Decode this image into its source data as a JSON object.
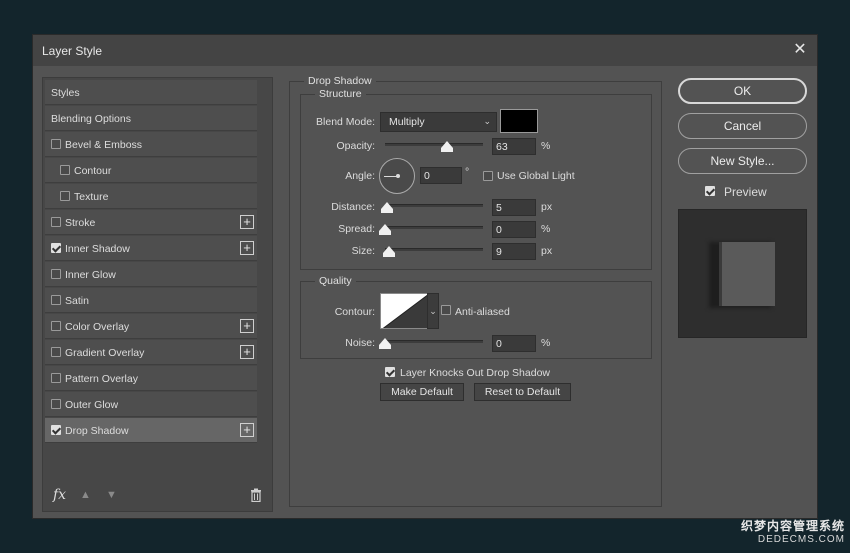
{
  "dialog": {
    "title": "Layer Style"
  },
  "styles_list": {
    "items": [
      {
        "label": "Styles",
        "has_checkbox": false,
        "checked": false,
        "indent": false,
        "has_plus": false,
        "selected": false
      },
      {
        "label": "Blending Options",
        "has_checkbox": false,
        "checked": false,
        "indent": false,
        "has_plus": false,
        "selected": false
      },
      {
        "label": "Bevel & Emboss",
        "has_checkbox": true,
        "checked": false,
        "indent": false,
        "has_plus": false,
        "selected": false
      },
      {
        "label": "Contour",
        "has_checkbox": true,
        "checked": false,
        "indent": true,
        "has_plus": false,
        "selected": false
      },
      {
        "label": "Texture",
        "has_checkbox": true,
        "checked": false,
        "indent": true,
        "has_plus": false,
        "selected": false
      },
      {
        "label": "Stroke",
        "has_checkbox": true,
        "checked": false,
        "indent": false,
        "has_plus": true,
        "selected": false
      },
      {
        "label": "Inner Shadow",
        "has_checkbox": true,
        "checked": true,
        "indent": false,
        "has_plus": true,
        "selected": false
      },
      {
        "label": "Inner Glow",
        "has_checkbox": true,
        "checked": false,
        "indent": false,
        "has_plus": false,
        "selected": false
      },
      {
        "label": "Satin",
        "has_checkbox": true,
        "checked": false,
        "indent": false,
        "has_plus": false,
        "selected": false
      },
      {
        "label": "Color Overlay",
        "has_checkbox": true,
        "checked": false,
        "indent": false,
        "has_plus": true,
        "selected": false
      },
      {
        "label": "Gradient Overlay",
        "has_checkbox": true,
        "checked": false,
        "indent": false,
        "has_plus": true,
        "selected": false
      },
      {
        "label": "Pattern Overlay",
        "has_checkbox": true,
        "checked": false,
        "indent": false,
        "has_plus": false,
        "selected": false
      },
      {
        "label": "Outer Glow",
        "has_checkbox": true,
        "checked": false,
        "indent": false,
        "has_plus": false,
        "selected": false
      },
      {
        "label": "Drop Shadow",
        "has_checkbox": true,
        "checked": true,
        "indent": false,
        "has_plus": true,
        "selected": true
      }
    ],
    "plus_glyph": "+",
    "bottom": {
      "fx": "fx",
      "up": "▲",
      "down": "▼"
    }
  },
  "drop_shadow": {
    "section_title": "Drop Shadow",
    "structure": {
      "title": "Structure",
      "blend_mode_label": "Blend Mode:",
      "blend_mode_value": "Multiply",
      "shadow_color": "#000000",
      "opacity_label": "Opacity:",
      "opacity_value": "63",
      "opacity_unit": "%",
      "opacity_fraction": 0.63,
      "angle_label": "Angle:",
      "angle_value": "0",
      "angle_unit": "°",
      "use_global_light_label": "Use Global Light",
      "use_global_light_checked": false,
      "distance_label": "Distance:",
      "distance_value": "5",
      "distance_unit": "px",
      "distance_fraction": 0.02,
      "spread_label": "Spread:",
      "spread_value": "0",
      "spread_unit": "%",
      "spread_fraction": 0.0,
      "size_label": "Size:",
      "size_value": "9",
      "size_unit": "px",
      "size_fraction": 0.04
    },
    "quality": {
      "title": "Quality",
      "contour_label": "Contour:",
      "anti_aliased_label": "Anti-aliased",
      "anti_aliased_checked": false,
      "noise_label": "Noise:",
      "noise_value": "0",
      "noise_unit": "%",
      "noise_fraction": 0.0
    },
    "knocks_out_label": "Layer Knocks Out Drop Shadow",
    "knocks_out_checked": true,
    "make_default_label": "Make Default",
    "reset_default_label": "Reset to Default"
  },
  "actions": {
    "ok_label": "OK",
    "cancel_label": "Cancel",
    "new_style_label": "New Style...",
    "preview_label": "Preview",
    "preview_checked": true
  },
  "watermark": {
    "line1": "织梦内容管理系统",
    "line2": "DEDECMS.COM"
  }
}
